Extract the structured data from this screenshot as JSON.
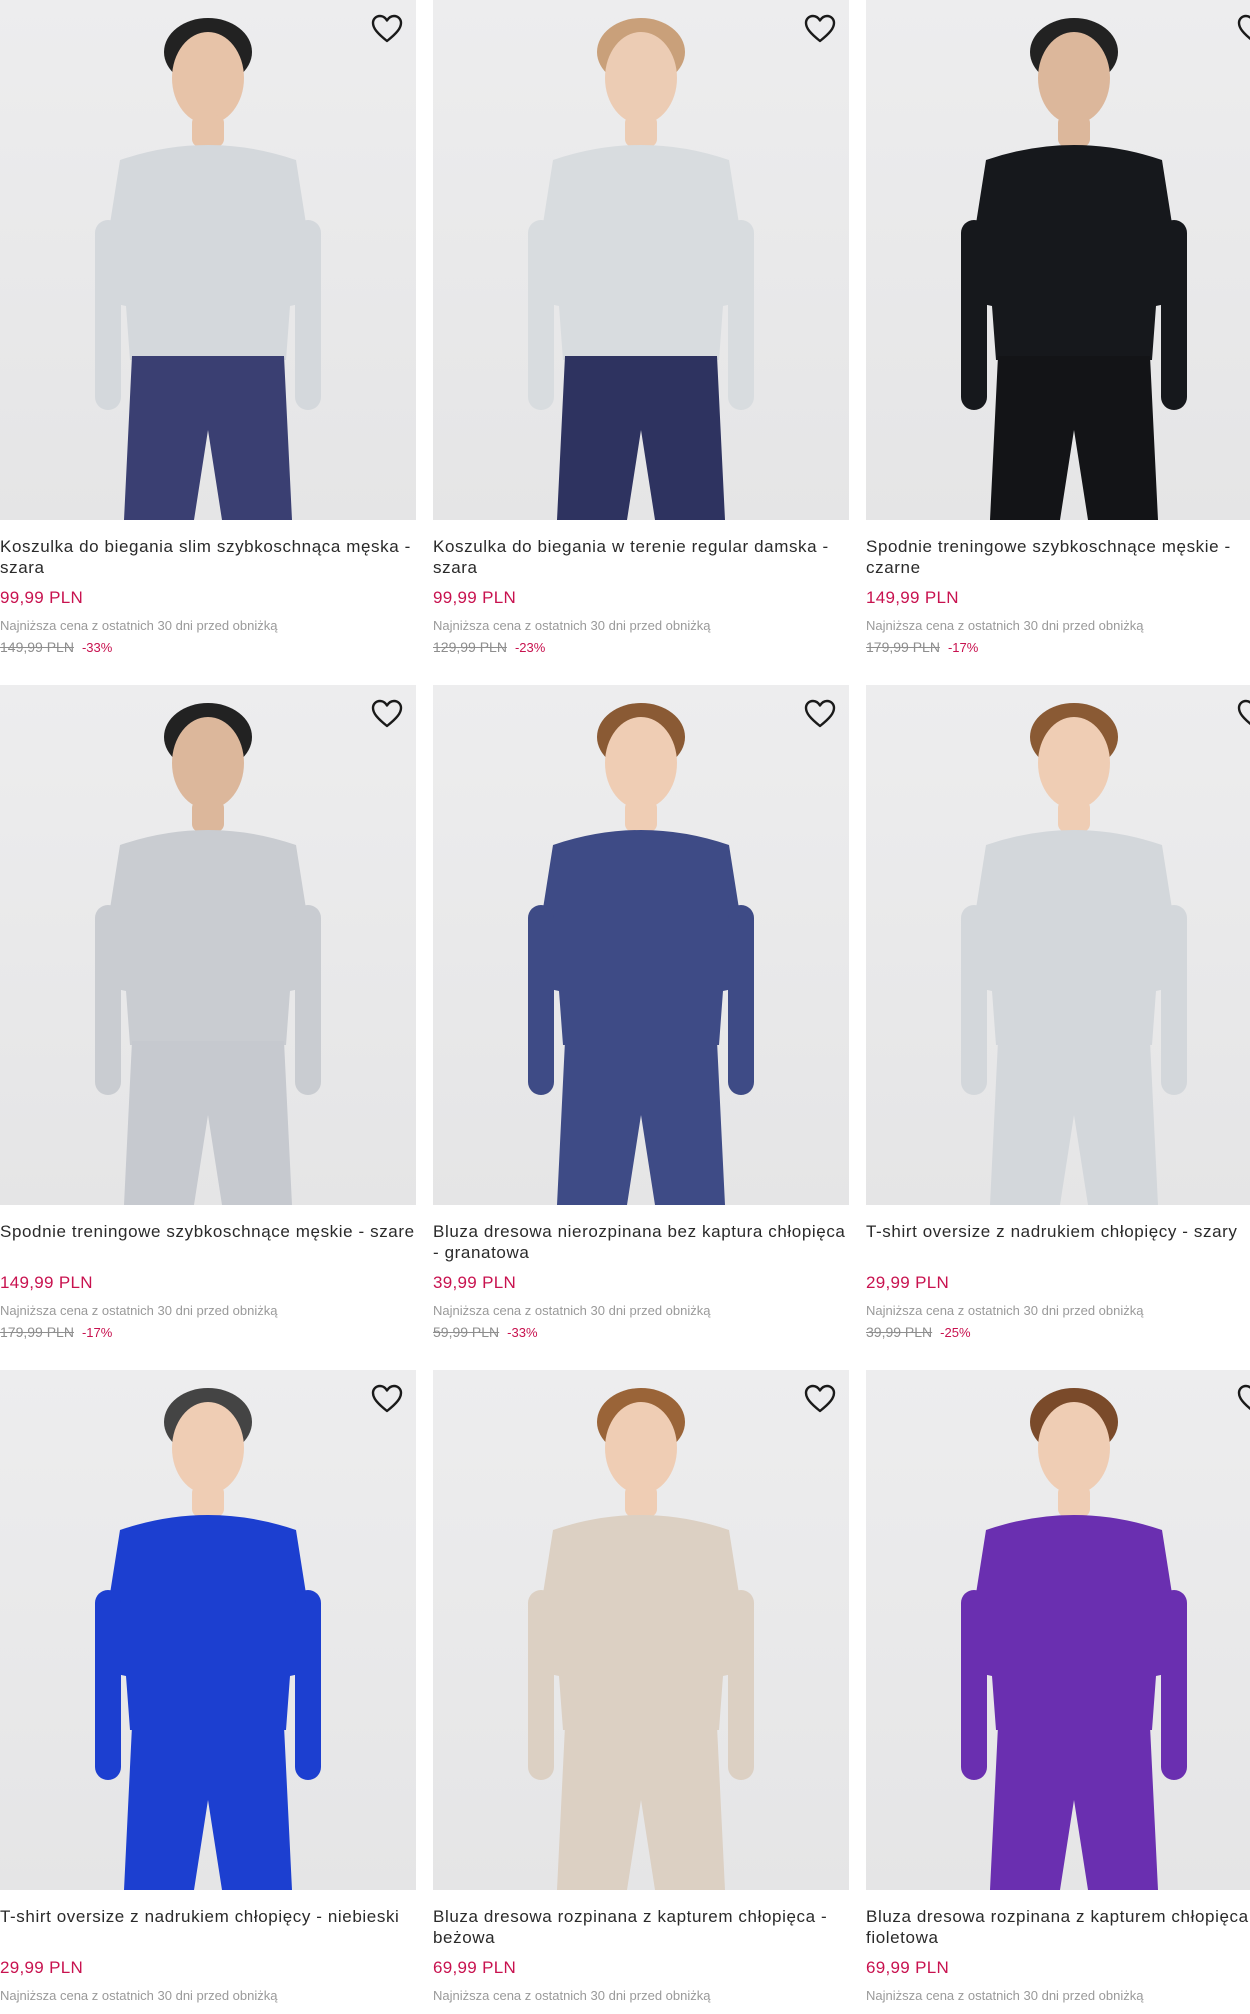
{
  "products": [
    {
      "name": "Koszulka do biegania slim szybkoschnąca męska - szara",
      "price": "99,99 PLN",
      "lowest_note": "Najniższa cena z ostatnich 30 dni przed obniżką",
      "old_price": "149,99 PLN",
      "discount": "-33%",
      "colors": {
        "top": "#d4d8dc",
        "bottom": "#3a3f72",
        "skin": "#e7c3a8",
        "hair": "#222"
      }
    },
    {
      "name": "Koszulka do biegania w terenie regular damska - szara",
      "price": "99,99 PLN",
      "lowest_note": "Najniższa cena z ostatnich 30 dni przed obniżką",
      "old_price": "129,99 PLN",
      "discount": "-23%",
      "colors": {
        "top": "#d8dcdf",
        "bottom": "#2e3360",
        "skin": "#ecccb4",
        "hair": "#c9a07a"
      }
    },
    {
      "name": "Spodnie treningowe szybkoschnące męskie - czarne",
      "price": "149,99 PLN",
      "lowest_note": "Najniższa cena z ostatnich 30 dni przed obniżką",
      "old_price": "179,99 PLN",
      "discount": "-17%",
      "colors": {
        "top": "#16181c",
        "bottom": "#131417",
        "skin": "#dcb79b",
        "hair": "#222"
      }
    },
    {
      "name": "Spodnie treningowe szybkoschnące męskie - szare",
      "price": "149,99 PLN",
      "lowest_note": "Najniższa cena z ostatnich 30 dni przed obniżką",
      "old_price": "179,99 PLN",
      "discount": "-17%",
      "colors": {
        "top": "#c9ccd1",
        "bottom": "#c6c9cf",
        "skin": "#dcb79b",
        "hair": "#222"
      }
    },
    {
      "name": "Bluza dresowa nierozpinana bez kaptura chłopięca - granatowa",
      "price": "39,99 PLN",
      "lowest_note": "Najniższa cena z ostatnich 30 dni przed obniżką",
      "old_price": "59,99 PLN",
      "discount": "-33%",
      "colors": {
        "top": "#3e4b86",
        "bottom": "#3e4b86",
        "skin": "#efcdb4",
        "hair": "#8a5a34"
      }
    },
    {
      "name": "T-shirt oversize z nadrukiem chłopięcy - szary",
      "price": "29,99 PLN",
      "lowest_note": "Najniższa cena z ostatnich 30 dni przed obniżką",
      "old_price": "39,99 PLN",
      "discount": "-25%",
      "colors": {
        "top": "#d3d7db",
        "bottom": "#d3d7db",
        "skin": "#efcdb4",
        "hair": "#8a5a34"
      }
    },
    {
      "name": "T-shirt oversize z nadrukiem chłopięcy - niebieski",
      "price": "29,99 PLN",
      "lowest_note": "Najniższa cena z ostatnich 30 dni przed obniżką",
      "old_price": "",
      "discount": "",
      "colors": {
        "top": "#1c3fd0",
        "bottom": "#1c3fd0",
        "skin": "#efcdb4",
        "hair": "#444"
      }
    },
    {
      "name": "Bluza dresowa rozpinana z kapturem chłopięca - beżowa",
      "price": "69,99 PLN",
      "lowest_note": "Najniższa cena z ostatnich 30 dni przed obniżką",
      "old_price": "",
      "discount": "",
      "colors": {
        "top": "#dcd0c3",
        "bottom": "#dcd0c3",
        "skin": "#efcdb4",
        "hair": "#9a6438"
      }
    },
    {
      "name": "Bluza dresowa rozpinana z kapturem chłopięca - fioletowa",
      "price": "69,99 PLN",
      "lowest_note": "Najniższa cena z ostatnich 30 dni przed obniżką",
      "old_price": "",
      "discount": "",
      "colors": {
        "top": "#6a2fb0",
        "bottom": "#6a2fb0",
        "skin": "#efcdb4",
        "hair": "#7a4a2a"
      }
    }
  ]
}
